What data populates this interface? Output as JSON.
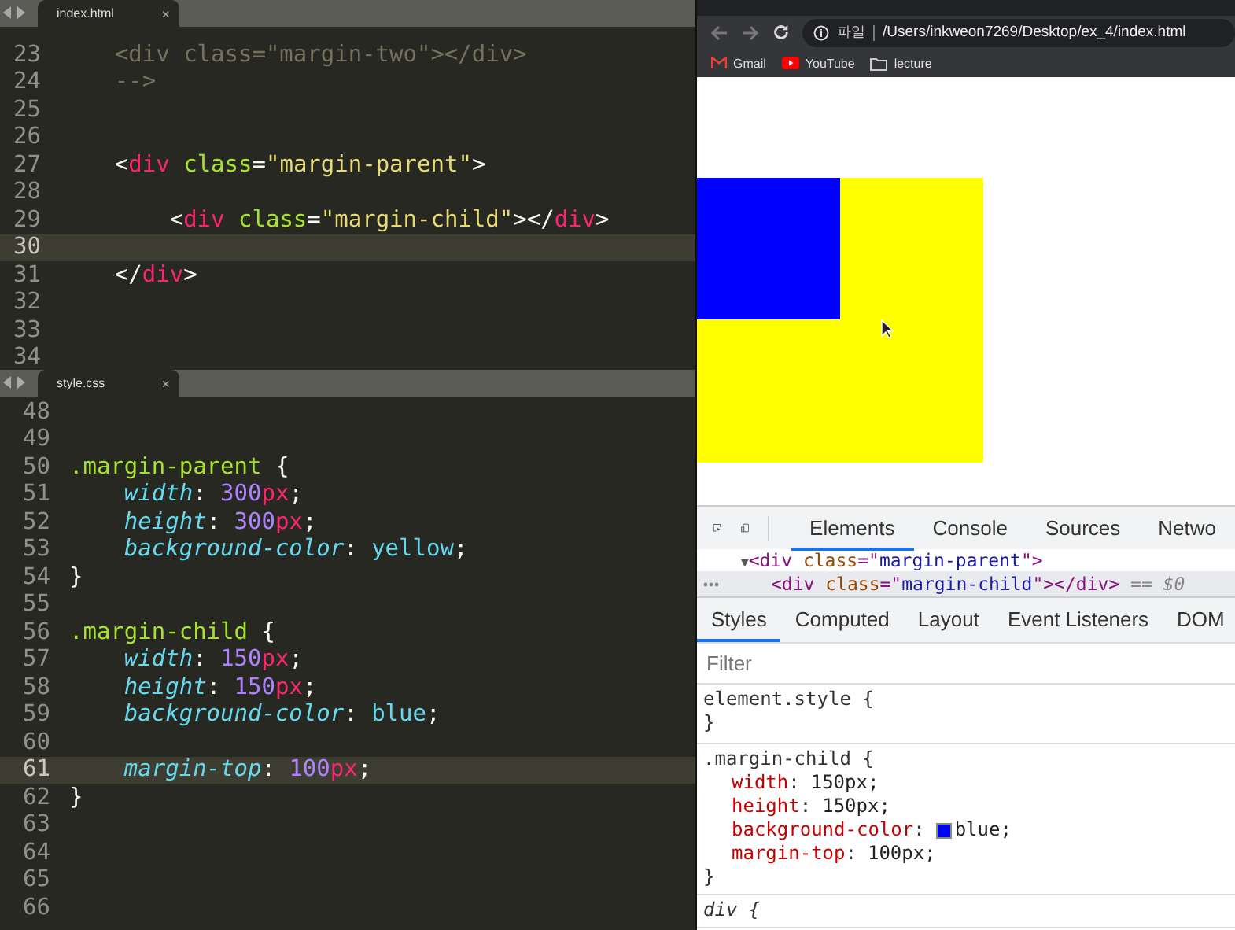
{
  "editors": [
    {
      "tab": {
        "label": "index.html",
        "close": "×",
        "selected": true
      },
      "lines": [
        {
          "number": "23",
          "current": false,
          "tokens": [
            {
              "t": "    <div class=\"margin-two\"></div>",
              "kind": "comment"
            }
          ]
        },
        {
          "number": "24",
          "current": false,
          "tokens": [
            {
              "t": "    -->",
              "kind": "comment"
            }
          ]
        },
        {
          "number": "25",
          "current": false
        },
        {
          "number": "26",
          "current": false
        },
        {
          "number": "27",
          "current": false,
          "tokens": [
            {
              "t": "    <",
              "kind": "punct"
            },
            {
              "t": "div",
              "kind": "tag"
            },
            {
              "t": " class",
              "kind": "attr"
            },
            {
              "t": "=",
              "kind": "punct"
            },
            {
              "t": "\"margin-parent\"",
              "kind": "string"
            },
            {
              "t": ">",
              "kind": "punct"
            }
          ]
        },
        {
          "number": "28",
          "current": false
        },
        {
          "number": "29",
          "current": false,
          "tokens": [
            {
              "t": "        <",
              "kind": "punct"
            },
            {
              "t": "div",
              "kind": "tag"
            },
            {
              "t": " class",
              "kind": "attr"
            },
            {
              "t": "=",
              "kind": "punct"
            },
            {
              "t": "\"margin-child\"",
              "kind": "string"
            },
            {
              "t": "></",
              "kind": "punct"
            },
            {
              "t": "div",
              "kind": "tag"
            },
            {
              "t": ">",
              "kind": "punct"
            }
          ]
        },
        {
          "number": "30",
          "current": true
        },
        {
          "number": "31",
          "current": false,
          "tokens": [
            {
              "t": "    </",
              "kind": "punct"
            },
            {
              "t": "div",
              "kind": "tag"
            },
            {
              "t": ">",
              "kind": "punct"
            }
          ]
        },
        {
          "number": "32",
          "current": false
        },
        {
          "number": "33",
          "current": false
        },
        {
          "number": "34",
          "current": false
        }
      ]
    },
    {
      "tab": {
        "label": "style.css",
        "close": "×",
        "selected": true
      },
      "lines": [
        {
          "number": "48",
          "current": false
        },
        {
          "number": "49",
          "current": false
        },
        {
          "number": "50",
          "current": false,
          "tokens": [
            {
              "t": ".margin-parent",
              "kind": "selector"
            },
            {
              "t": " {",
              "kind": "punct"
            }
          ]
        },
        {
          "number": "51",
          "current": false,
          "tokens": [
            {
              "t": "    width",
              "kind": "prop"
            },
            {
              "t": ": ",
              "kind": "punct"
            },
            {
              "t": "300",
              "kind": "number"
            },
            {
              "t": "px",
              "kind": "unit"
            },
            {
              "t": ";",
              "kind": "punct"
            }
          ]
        },
        {
          "number": "52",
          "current": false,
          "tokens": [
            {
              "t": "    height",
              "kind": "prop"
            },
            {
              "t": ": ",
              "kind": "punct"
            },
            {
              "t": "300",
              "kind": "number"
            },
            {
              "t": "px",
              "kind": "unit"
            },
            {
              "t": ";",
              "kind": "punct"
            }
          ]
        },
        {
          "number": "53",
          "current": false,
          "tokens": [
            {
              "t": "    background-color",
              "kind": "prop"
            },
            {
              "t": ": ",
              "kind": "punct"
            },
            {
              "t": "yellow",
              "kind": "value"
            },
            {
              "t": ";",
              "kind": "punct"
            }
          ]
        },
        {
          "number": "54",
          "current": false,
          "tokens": [
            {
              "t": "}",
              "kind": "punct"
            }
          ]
        },
        {
          "number": "55",
          "current": false
        },
        {
          "number": "56",
          "current": false,
          "tokens": [
            {
              "t": ".margin-child",
              "kind": "selector"
            },
            {
              "t": " {",
              "kind": "punct"
            }
          ]
        },
        {
          "number": "57",
          "current": false,
          "tokens": [
            {
              "t": "    width",
              "kind": "prop"
            },
            {
              "t": ": ",
              "kind": "punct"
            },
            {
              "t": "150",
              "kind": "number"
            },
            {
              "t": "px",
              "kind": "unit"
            },
            {
              "t": ";",
              "kind": "punct"
            }
          ]
        },
        {
          "number": "58",
          "current": false,
          "tokens": [
            {
              "t": "    height",
              "kind": "prop"
            },
            {
              "t": ": ",
              "kind": "punct"
            },
            {
              "t": "150",
              "kind": "number"
            },
            {
              "t": "px",
              "kind": "unit"
            },
            {
              "t": ";",
              "kind": "punct"
            }
          ]
        },
        {
          "number": "59",
          "current": false,
          "tokens": [
            {
              "t": "    background-color",
              "kind": "prop"
            },
            {
              "t": ": ",
              "kind": "punct"
            },
            {
              "t": "blue",
              "kind": "value"
            },
            {
              "t": ";",
              "kind": "punct"
            }
          ]
        },
        {
          "number": "60",
          "current": false
        },
        {
          "number": "61",
          "current": true,
          "tokens": [
            {
              "t": "    margin-top",
              "kind": "prop"
            },
            {
              "t": ": ",
              "kind": "punct"
            },
            {
              "t": "100",
              "kind": "number"
            },
            {
              "t": "px",
              "kind": "unit"
            },
            {
              "t": ";",
              "kind": "punct"
            }
          ]
        },
        {
          "number": "62",
          "current": false,
          "tokens": [
            {
              "t": "}",
              "kind": "punct"
            }
          ]
        },
        {
          "number": "63",
          "current": false
        },
        {
          "number": "64",
          "current": false
        },
        {
          "number": "65",
          "current": false
        },
        {
          "number": "66",
          "current": false
        }
      ]
    }
  ],
  "browser": {
    "address": {
      "scheme": "파일",
      "url": "/Users/inkweon7269/Desktop/ex_4/index.html"
    },
    "bookmarks": [
      {
        "label": "Gmail",
        "kind": "gmail"
      },
      {
        "label": "YouTube",
        "kind": "youtube"
      },
      {
        "label": "lecture",
        "kind": "folder"
      }
    ]
  },
  "devtools": {
    "tabs": [
      {
        "label": "Elements",
        "selected": true
      },
      {
        "label": "Console",
        "selected": false
      },
      {
        "label": "Sources",
        "selected": false
      },
      {
        "label": "Netwo",
        "selected": false
      }
    ],
    "dom_rows": [
      {
        "selected": false,
        "tokens": [
          {
            "t": "▼",
            "kind": "arrow"
          },
          {
            "t": "<div ",
            "kind": "tag"
          },
          {
            "t": "class",
            "kind": "attr"
          },
          {
            "t": "=\"",
            "kind": "tag"
          },
          {
            "t": "margin-parent",
            "kind": "val"
          },
          {
            "t": "\">",
            "kind": "tag"
          }
        ]
      },
      {
        "selected": true,
        "tokens": [
          {
            "t": "<div ",
            "kind": "tag"
          },
          {
            "t": "class",
            "kind": "attr"
          },
          {
            "t": "=\"",
            "kind": "tag"
          },
          {
            "t": "margin-child",
            "kind": "val"
          },
          {
            "t": "\"></div>",
            "kind": "tag"
          },
          {
            "t": " == $0",
            "kind": "ref"
          }
        ]
      }
    ],
    "style_tabs": [
      {
        "label": "Styles",
        "selected": true
      },
      {
        "label": "Computed",
        "selected": false
      },
      {
        "label": "Layout",
        "selected": false
      },
      {
        "label": "Event Listeners",
        "selected": false
      },
      {
        "label": "DOM",
        "selected": false
      }
    ],
    "filter": {
      "placeholder": "Filter"
    },
    "rules": [
      {
        "kind": "inline",
        "open": "element.style {",
        "close": "}"
      },
      {
        "kind": "author",
        "open": ".margin-child {",
        "close": "}",
        "props": [
          {
            "name": "width",
            "sep": ":",
            "value": "150px;"
          },
          {
            "name": "height",
            "sep": ":",
            "value": "150px;"
          },
          {
            "name": "background-color",
            "sep": ":",
            "value": "blue;",
            "color": "#0000ff"
          },
          {
            "name": "margin-top",
            "sep": ":",
            "value": "100px;"
          }
        ]
      },
      {
        "kind": "user-agent",
        "open": "div {"
      }
    ]
  }
}
